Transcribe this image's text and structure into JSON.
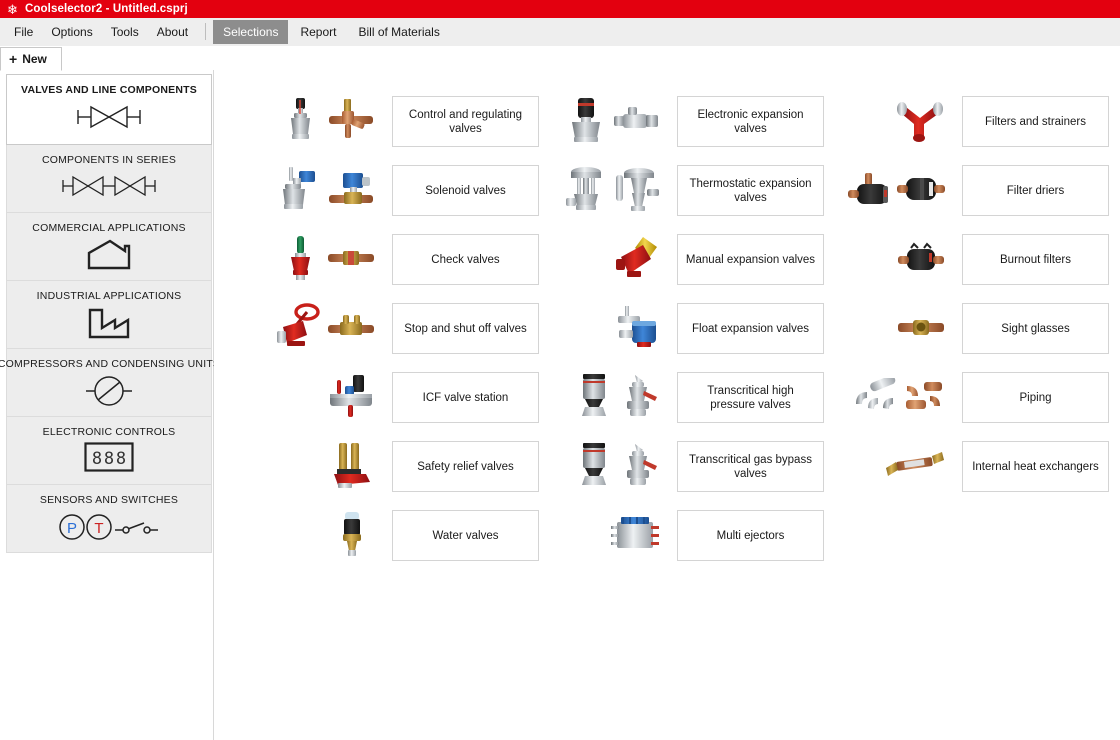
{
  "window": {
    "icon": "snowflake-icon",
    "title": "Coolselector2 - Untitled.csprj",
    "titlebar_color": "#e3000f"
  },
  "menubar": {
    "items": [
      {
        "label": "File",
        "active": false
      },
      {
        "label": "Options",
        "active": false
      },
      {
        "label": "Tools",
        "active": false
      },
      {
        "label": "About",
        "active": false
      }
    ],
    "modes": [
      {
        "label": "Selections",
        "active": true
      },
      {
        "label": "Report",
        "active": false
      },
      {
        "label": "Bill of Materials",
        "active": false
      }
    ],
    "active_color": "#8d8d8d"
  },
  "tabs": [
    {
      "label": "New",
      "icon": "plus-icon",
      "active": true
    }
  ],
  "sidebar": {
    "items": [
      {
        "label": "VALVES AND LINE COMPONENTS",
        "icon": "valve-symbol-icon",
        "selected": true
      },
      {
        "label": "COMPONENTS IN SERIES",
        "icon": "double-valve-symbol-icon",
        "selected": false
      },
      {
        "label": "COMMERCIAL APPLICATIONS",
        "icon": "shop-building-icon",
        "selected": false
      },
      {
        "label": "INDUSTRIAL APPLICATIONS",
        "icon": "factory-icon",
        "selected": false
      },
      {
        "label": "COMPRESSORS AND CONDENSING UNITS",
        "icon": "compressor-symbol-icon",
        "selected": false
      },
      {
        "label": "ELECTRONIC CONTROLS",
        "icon": "seven-segment-display-icon",
        "selected": false
      },
      {
        "label": "SENSORS AND SWITCHES",
        "icon": "pressure-temperature-switch-icon",
        "selected": false
      }
    ]
  },
  "catalog": {
    "columns": [
      {
        "items": [
          {
            "label": "Control and regulating valves",
            "thumbs": [
              "icv-regulating-valve-photo",
              "copper-line-valve-photo"
            ]
          },
          {
            "label": "Solenoid valves",
            "thumbs": [
              "industrial-solenoid-valve-photo",
              "blue-coil-solenoid-valve-photo"
            ]
          },
          {
            "label": "Check valves",
            "thumbs": [
              "green-red-check-valve-photo",
              "copper-inline-check-valve-photo"
            ]
          },
          {
            "label": "Stop and shut off valves",
            "thumbs": [
              "red-handwheel-stop-valve-photo",
              "brass-shutoff-valve-photo"
            ]
          },
          {
            "label": "ICF valve station",
            "thumbs": [
              "icf-valve-station-photo"
            ]
          },
          {
            "label": "Safety relief valves",
            "thumbs": [
              "dual-safety-relief-valve-photo"
            ]
          },
          {
            "label": "Water valves",
            "thumbs": [
              "water-regulating-valve-photo"
            ]
          }
        ]
      },
      {
        "items": [
          {
            "label": "Electronic expansion valves",
            "thumbs": [
              "electronic-expansion-valve-photo",
              "small-electronic-expansion-valve-photo"
            ]
          },
          {
            "label": "Thermostatic expansion valves",
            "thumbs": [
              "industrial-thermostatic-valve-photo",
              "thermostatic-expansion-valve-photo"
            ]
          },
          {
            "label": "Manual expansion valves",
            "thumbs": [
              "red-yellow-manual-expansion-valve-photo"
            ]
          },
          {
            "label": "Float expansion valves",
            "thumbs": [
              "float-expansion-valve-photo"
            ]
          },
          {
            "label": "Transcritical high pressure valves",
            "thumbs": [
              "transcritical-actuator-valve-photo",
              "transcritical-hp-valve-photo"
            ]
          },
          {
            "label": "Transcritical gas bypass valves",
            "thumbs": [
              "transcritical-actuator-valve-photo",
              "transcritical-bypass-valve-photo"
            ]
          },
          {
            "label": "Multi ejectors",
            "thumbs": [
              "multi-ejector-module-photo"
            ]
          }
        ]
      },
      {
        "items": [
          {
            "label": "Filters and strainers",
            "thumbs": [
              "red-y-strainer-photo"
            ]
          },
          {
            "label": "Filter driers",
            "thumbs": [
              "angled-filter-drier-photo",
              "inline-filter-drier-photo"
            ]
          },
          {
            "label": "Burnout filters",
            "thumbs": [
              "burnout-filter-photo"
            ]
          },
          {
            "label": "Sight glasses",
            "thumbs": [
              "copper-sight-glass-photo"
            ]
          },
          {
            "label": "Piping",
            "thumbs": [
              "steel-pipe-fittings-photo",
              "copper-pipe-fittings-photo"
            ]
          },
          {
            "label": "Internal heat exchangers",
            "thumbs": [
              "internal-heat-exchanger-photo"
            ]
          }
        ]
      }
    ]
  }
}
